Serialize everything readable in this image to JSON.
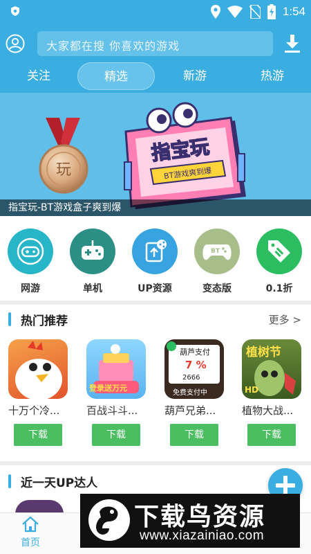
{
  "status_bar": {
    "time": "1:54",
    "icons": [
      "shield-icon",
      "location-icon",
      "wifi-icon",
      "no-sim-icon",
      "battery-charging-icon"
    ]
  },
  "header": {
    "search_placeholder": "大家都在搜  你喜欢的游戏",
    "tabs": [
      {
        "label": "关注",
        "active": false
      },
      {
        "label": "精选",
        "active": true
      },
      {
        "label": "新游",
        "active": false
      },
      {
        "label": "热游",
        "active": false
      }
    ]
  },
  "banner": {
    "caption": "指宝玩-BT游戏盒子爽到爆",
    "sign_title": "指宝玩",
    "sign_subtitle": "BT游戏爽到爆",
    "medal_char": "玩"
  },
  "categories": [
    {
      "label": "网游",
      "icon": "gamepad-icon",
      "color": "#27b5c8"
    },
    {
      "label": "单机",
      "icon": "controller-icon",
      "color": "#2c8f86"
    },
    {
      "label": "UP资源",
      "icon": "share-icon",
      "color": "#37a3e0"
    },
    {
      "label": "变态版",
      "icon": "bt-controller-icon",
      "color": "#a7bd8a"
    },
    {
      "label": "0.1折",
      "icon": "discount-tag-icon",
      "color": "#2dbd61"
    }
  ],
  "hot_section": {
    "title": "热门推荐",
    "more": "更多 >",
    "apps": [
      {
        "name": "十万个冷...",
        "button": "下载",
        "icon_text": ""
      },
      {
        "name": "百战斗斗...",
        "button": "下载",
        "icon_text": "登录送万元"
      },
      {
        "name": "葫芦兄弟...",
        "button": "下载",
        "icon_text": "葫芦支付",
        "icon_pct": "7 %",
        "icon_num": "2666",
        "icon_foot": "免费支付中"
      },
      {
        "name": "植物大战...",
        "button": "下载",
        "icon_text": "植树节",
        "icon_badge": "HD"
      }
    ]
  },
  "up_section": {
    "title": "近一天UP达人"
  },
  "bottom_nav": {
    "home_label": "首页"
  },
  "watermark": {
    "title": "下载鸟资源",
    "url": "www.xiazainiao.com"
  },
  "colors": {
    "primary": "#3aaee0",
    "download_green": "#4cbe62"
  }
}
